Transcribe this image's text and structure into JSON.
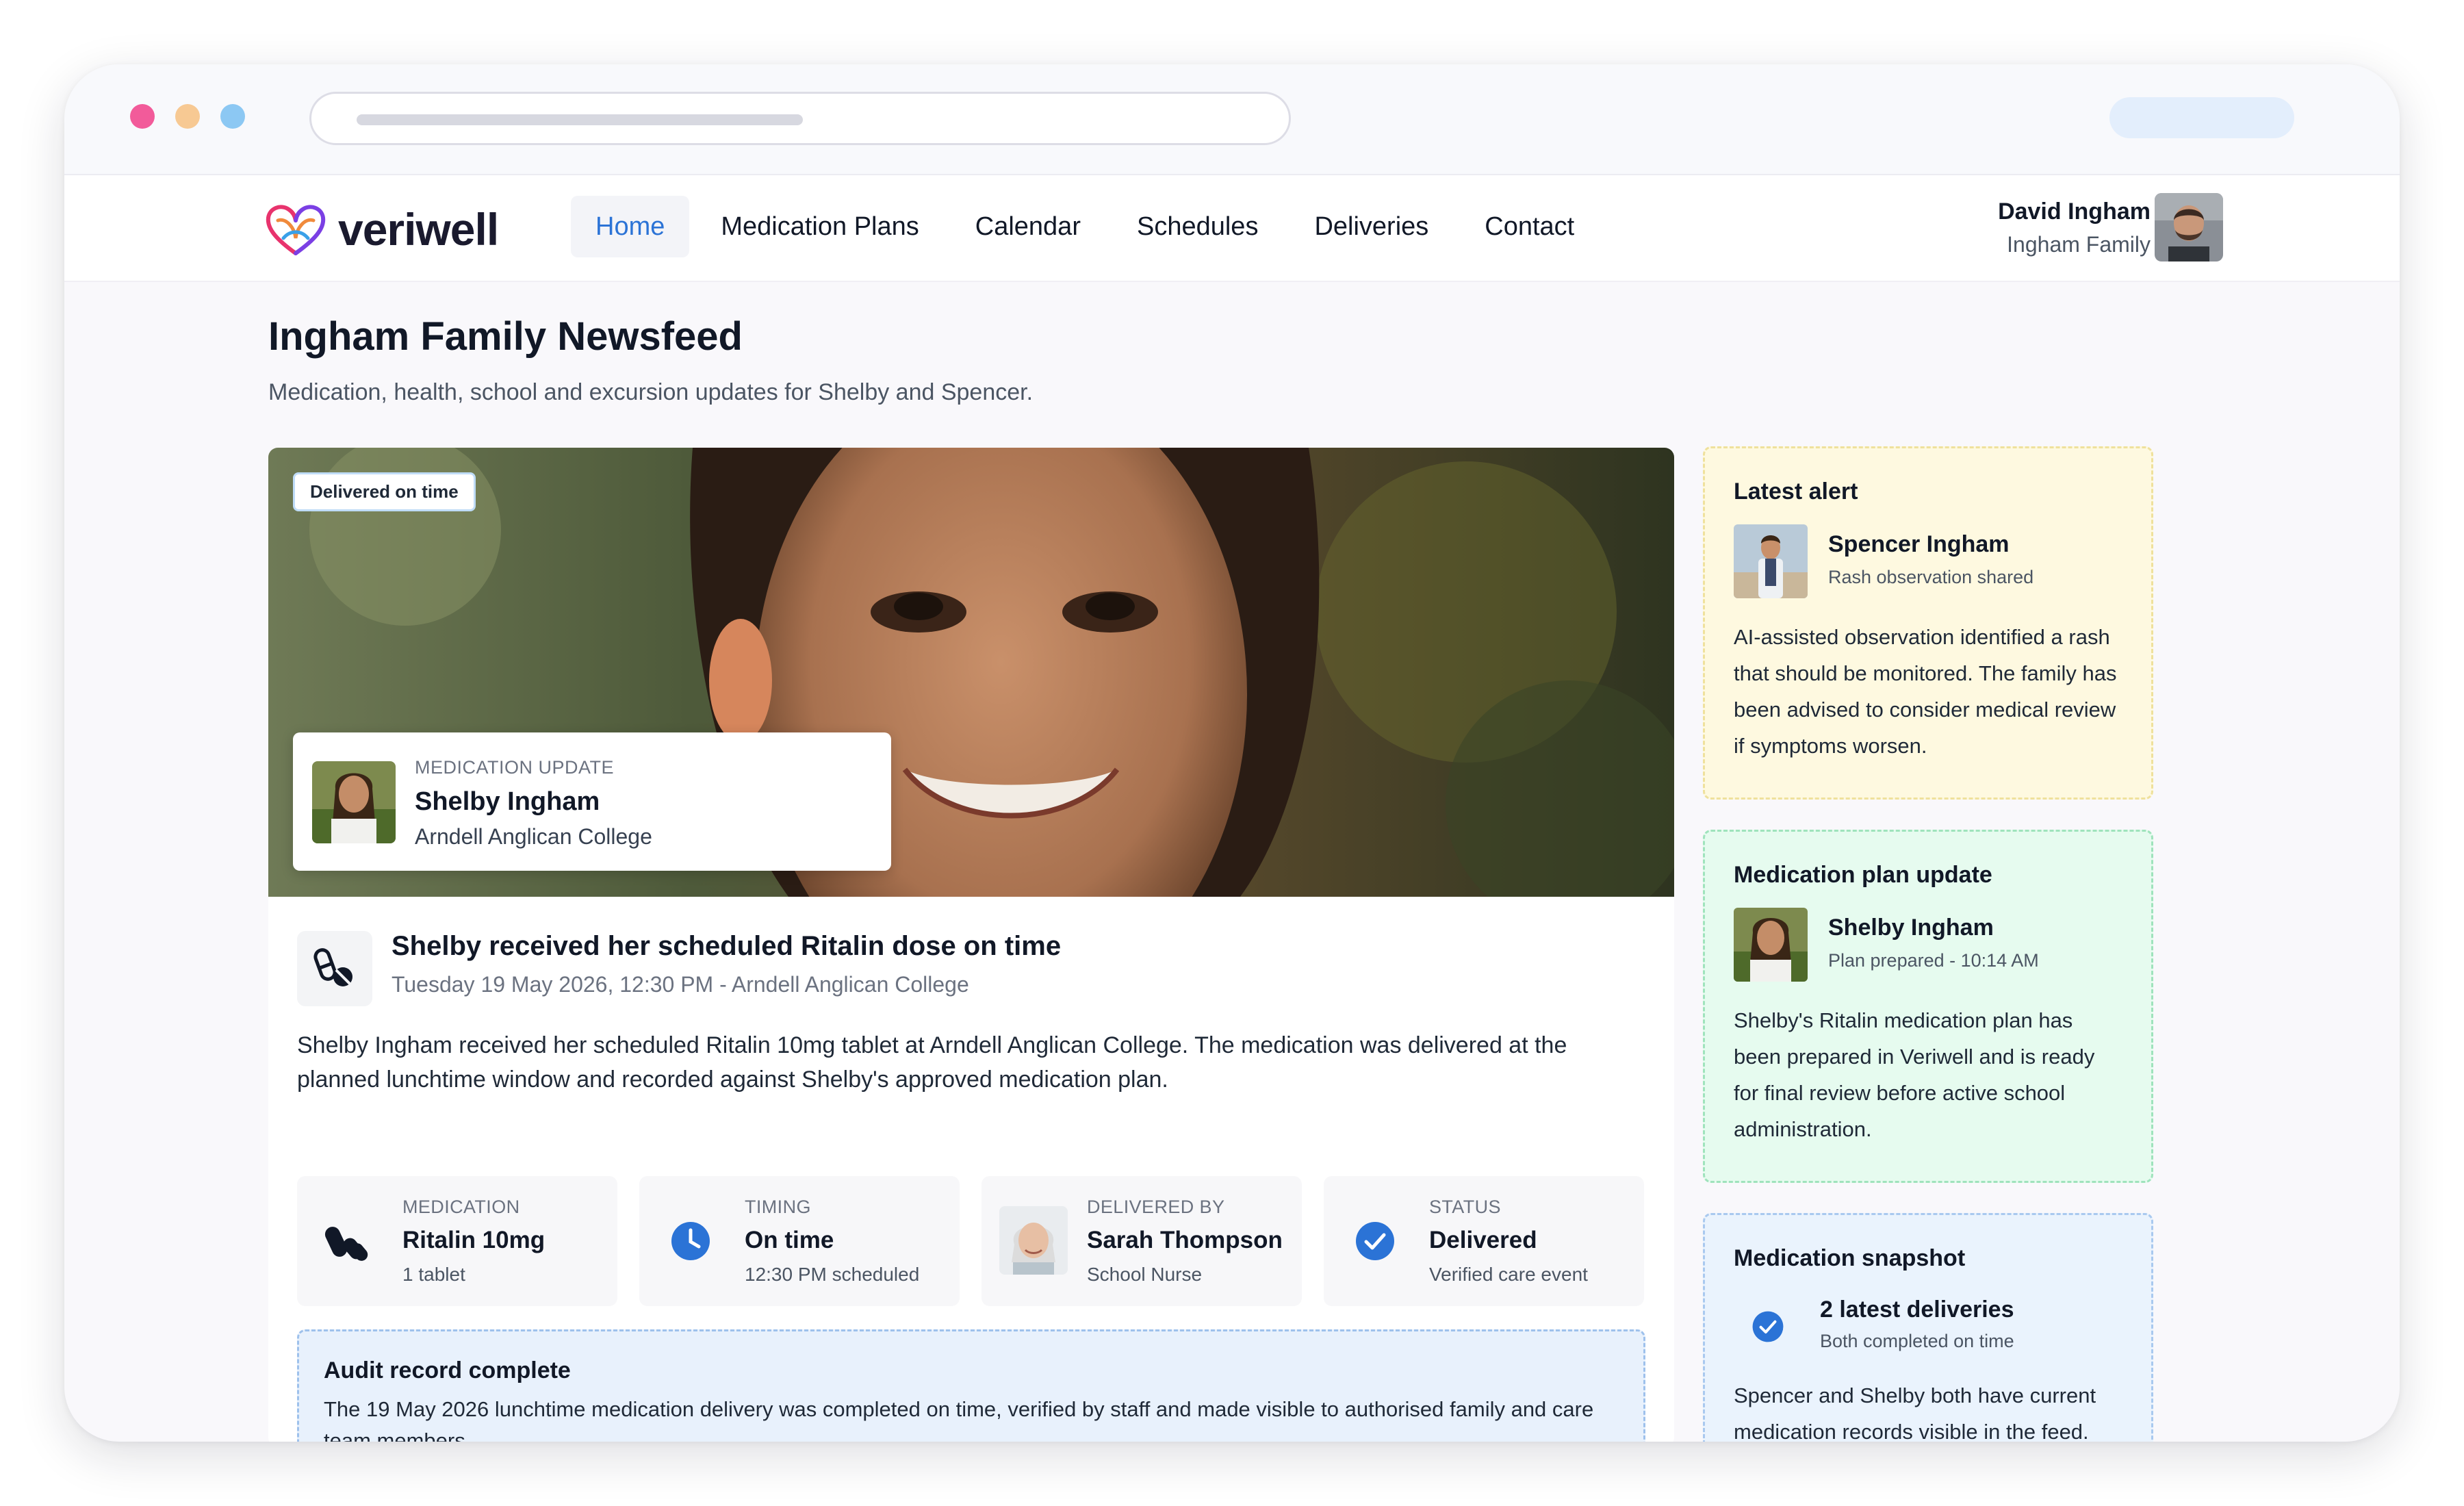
{
  "app": {
    "brand": "veriwell",
    "nav": [
      {
        "label": "Home",
        "active": true
      },
      {
        "label": "Medication Plans",
        "active": false
      },
      {
        "label": "Calendar",
        "active": false
      },
      {
        "label": "Schedules",
        "active": false
      },
      {
        "label": "Deliveries",
        "active": false
      },
      {
        "label": "Contact",
        "active": false
      }
    ],
    "user": {
      "name": "David Ingham",
      "family": "Ingham Family"
    },
    "accent": "#2b73d6"
  },
  "page": {
    "title": "Ingham Family Newsfeed",
    "subtitle": "Medication, health, school and excursion updates for Shelby and Spencer."
  },
  "post": {
    "badge": "Delivered on time",
    "update_kicker": "MEDICATION UPDATE",
    "update_name": "Shelby Ingham",
    "update_school": "Arndell Anglican College",
    "title": "Shelby received her scheduled Ritalin dose on time",
    "meta": "Tuesday 19 May 2026, 12:30 PM - Arndell Anglican College",
    "body": "Shelby Ingham received her scheduled Ritalin 10mg tablet at Arndell Anglican College. The medication was delivered at the planned lunchtime window and recorded against Shelby's approved medication plan.",
    "tiles": [
      {
        "label": "MEDICATION",
        "value": "Ritalin 10mg",
        "sub": "1 tablet",
        "icon": "pills-icon"
      },
      {
        "label": "TIMING",
        "value": "On time",
        "sub": "12:30 PM scheduled",
        "icon": "clock-icon"
      },
      {
        "label": "DELIVERED BY",
        "value": "Sarah Thompson",
        "sub": "School Nurse",
        "icon": "nurse-avatar"
      },
      {
        "label": "STATUS",
        "value": "Delivered",
        "sub": "Verified care event",
        "icon": "check-icon"
      }
    ],
    "audit": {
      "title": "Audit record complete",
      "desc": "The 19 May 2026 lunchtime medication delivery was completed on time, verified by staff and made visible to authorised family and care team members."
    }
  },
  "sidebar": {
    "alert": {
      "heading": "Latest alert",
      "name": "Spencer Ingham",
      "sub": "Rash observation shared",
      "body": "AI-assisted observation identified a rash that should be monitored. The family has been advised to consider medical review if symptoms worsen."
    },
    "plan": {
      "heading": "Medication plan update",
      "name": "Shelby Ingham",
      "sub": "Plan prepared - 10:14 AM",
      "body": "Shelby's Ritalin medication plan has been prepared in Veriwell and is ready for final review before active school administration."
    },
    "snapshot": {
      "heading": "Medication snapshot",
      "row_title": "2 latest deliveries",
      "row_sub": "Both completed on time",
      "body": "Spencer and Shelby both have current medication records visible in the feed."
    }
  }
}
